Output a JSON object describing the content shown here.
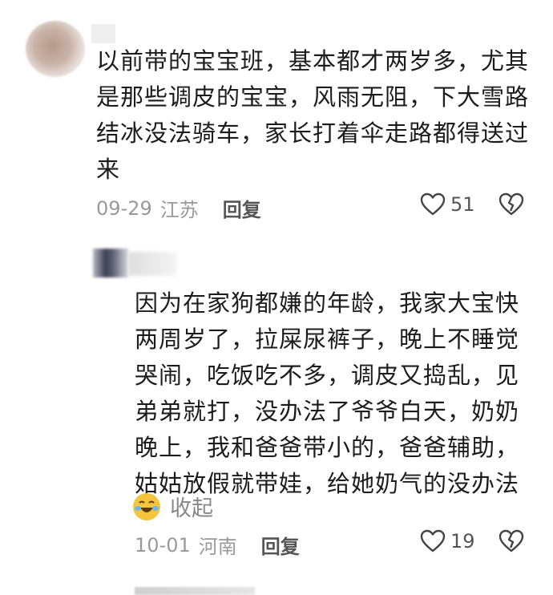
{
  "comments": [
    {
      "text": "以前带的宝宝班，基本都才两岁多，尤其\n是那些调皮的宝宝，风雨无阻，下大雪路\n结冰没法骑车，家长打着伞走路都得送过\n来",
      "date": "09-29",
      "location": "江苏",
      "reply_label": "回复",
      "likes": "51"
    }
  ],
  "replies": [
    {
      "text": "因为在家狗都嫌的年龄，我家大宝快\n两周岁了，拉屎尿裤子，晚上不睡觉\n哭闹，吃饭吃不多，调皮又捣乱，见\n弟弟就打，没办法了爷爷白天，奶奶\n晚上，我和爸爸带小的，爸爸辅助，\n姑姑放假就带娃，给她奶气的没办法",
      "collapse_label": "收起",
      "date": "10-01",
      "location": "河南",
      "reply_label": "回复",
      "likes": "19"
    }
  ],
  "icons": {
    "like": "heart-icon",
    "dislike": "broken-heart-icon",
    "emoji": "laughing-crying-emoji"
  }
}
